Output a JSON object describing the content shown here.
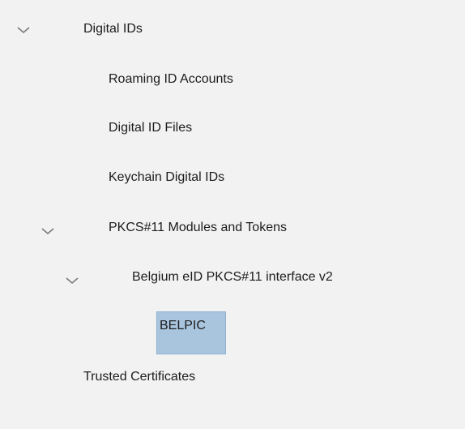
{
  "tree": {
    "digital_ids": "Digital IDs",
    "roaming_id_accounts": "Roaming ID Accounts",
    "digital_id_files": "Digital ID Files",
    "keychain_digital_ids": "Keychain Digital IDs",
    "pkcs11_modules": "PKCS#11 Modules and Tokens",
    "belgium_eid": "Belgium eID PKCS#11 interface v2",
    "belpic": "BELPIC",
    "trusted_certificates": "Trusted Certificates"
  },
  "icons": {
    "expand": "chevron-down-icon"
  },
  "colors": {
    "background": "#f2f2f2",
    "selection": "#a9c5de",
    "text": "#1c1c1c",
    "chevron": "#7a7a7a"
  }
}
